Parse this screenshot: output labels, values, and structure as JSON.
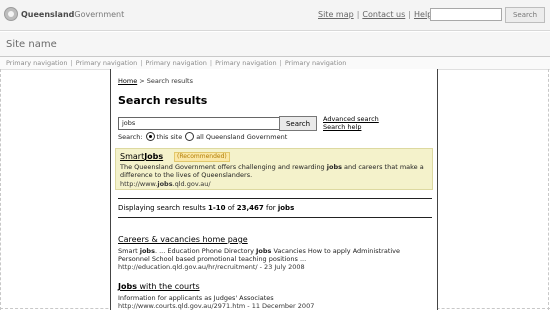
{
  "header": {
    "logo_bold": "Queensland",
    "logo_rest": "Government",
    "links": [
      "Site map",
      "Contact us",
      "Help"
    ],
    "search_button": "Search"
  },
  "site_name": "Site name",
  "primary_nav": [
    "Primary navigation",
    "Primary navigation",
    "Primary navigation",
    "Primary navigation",
    "Primary navigation"
  ],
  "breadcrumb": {
    "home": "Home",
    "current": "Search results"
  },
  "page_title": "Search results",
  "search": {
    "query": "jobs",
    "button": "Search",
    "advanced_link": "Advanced search",
    "help_link": "Search help",
    "scope_label": "Search:",
    "scope_options": [
      "this site",
      "all Queensland Government"
    ]
  },
  "featured": {
    "title_a": "Smart",
    "title_b": "Jobs",
    "badge": "(Recommended)",
    "desc_a": "The Queensland Government offers challenging and rewarding ",
    "desc_b": "jobs",
    "desc_c": " and careers that make a difference to the lives of Queenslanders.",
    "url_a": "http://www.",
    "url_b": "jobs",
    "url_c": ".qld.gov.au/"
  },
  "summary": {
    "prefix": "Displaying search results ",
    "range": "1-10",
    "of": " of ",
    "total": "23,467",
    "for": " for ",
    "term": "jobs"
  },
  "results": [
    {
      "title": "Careers & vacancies home page",
      "desc_a": "Smart ",
      "desc_b": "jobs",
      "desc_c": ". ... Education Phone Directory ",
      "desc_d": "Jobs",
      "desc_e": " Vacancies How to apply Administrative Personnel School based promotional teaching positions ...",
      "url": "http://education.qld.gov.au/hr/recruitment/ - 23 July 2008"
    },
    {
      "title_a": "Jobs",
      "title_b": " with the courts",
      "desc": "Information for applicants as Judges' Associates",
      "url": "http://www.courts.qld.gov.au/2971.htm - 11 December 2007"
    }
  ]
}
